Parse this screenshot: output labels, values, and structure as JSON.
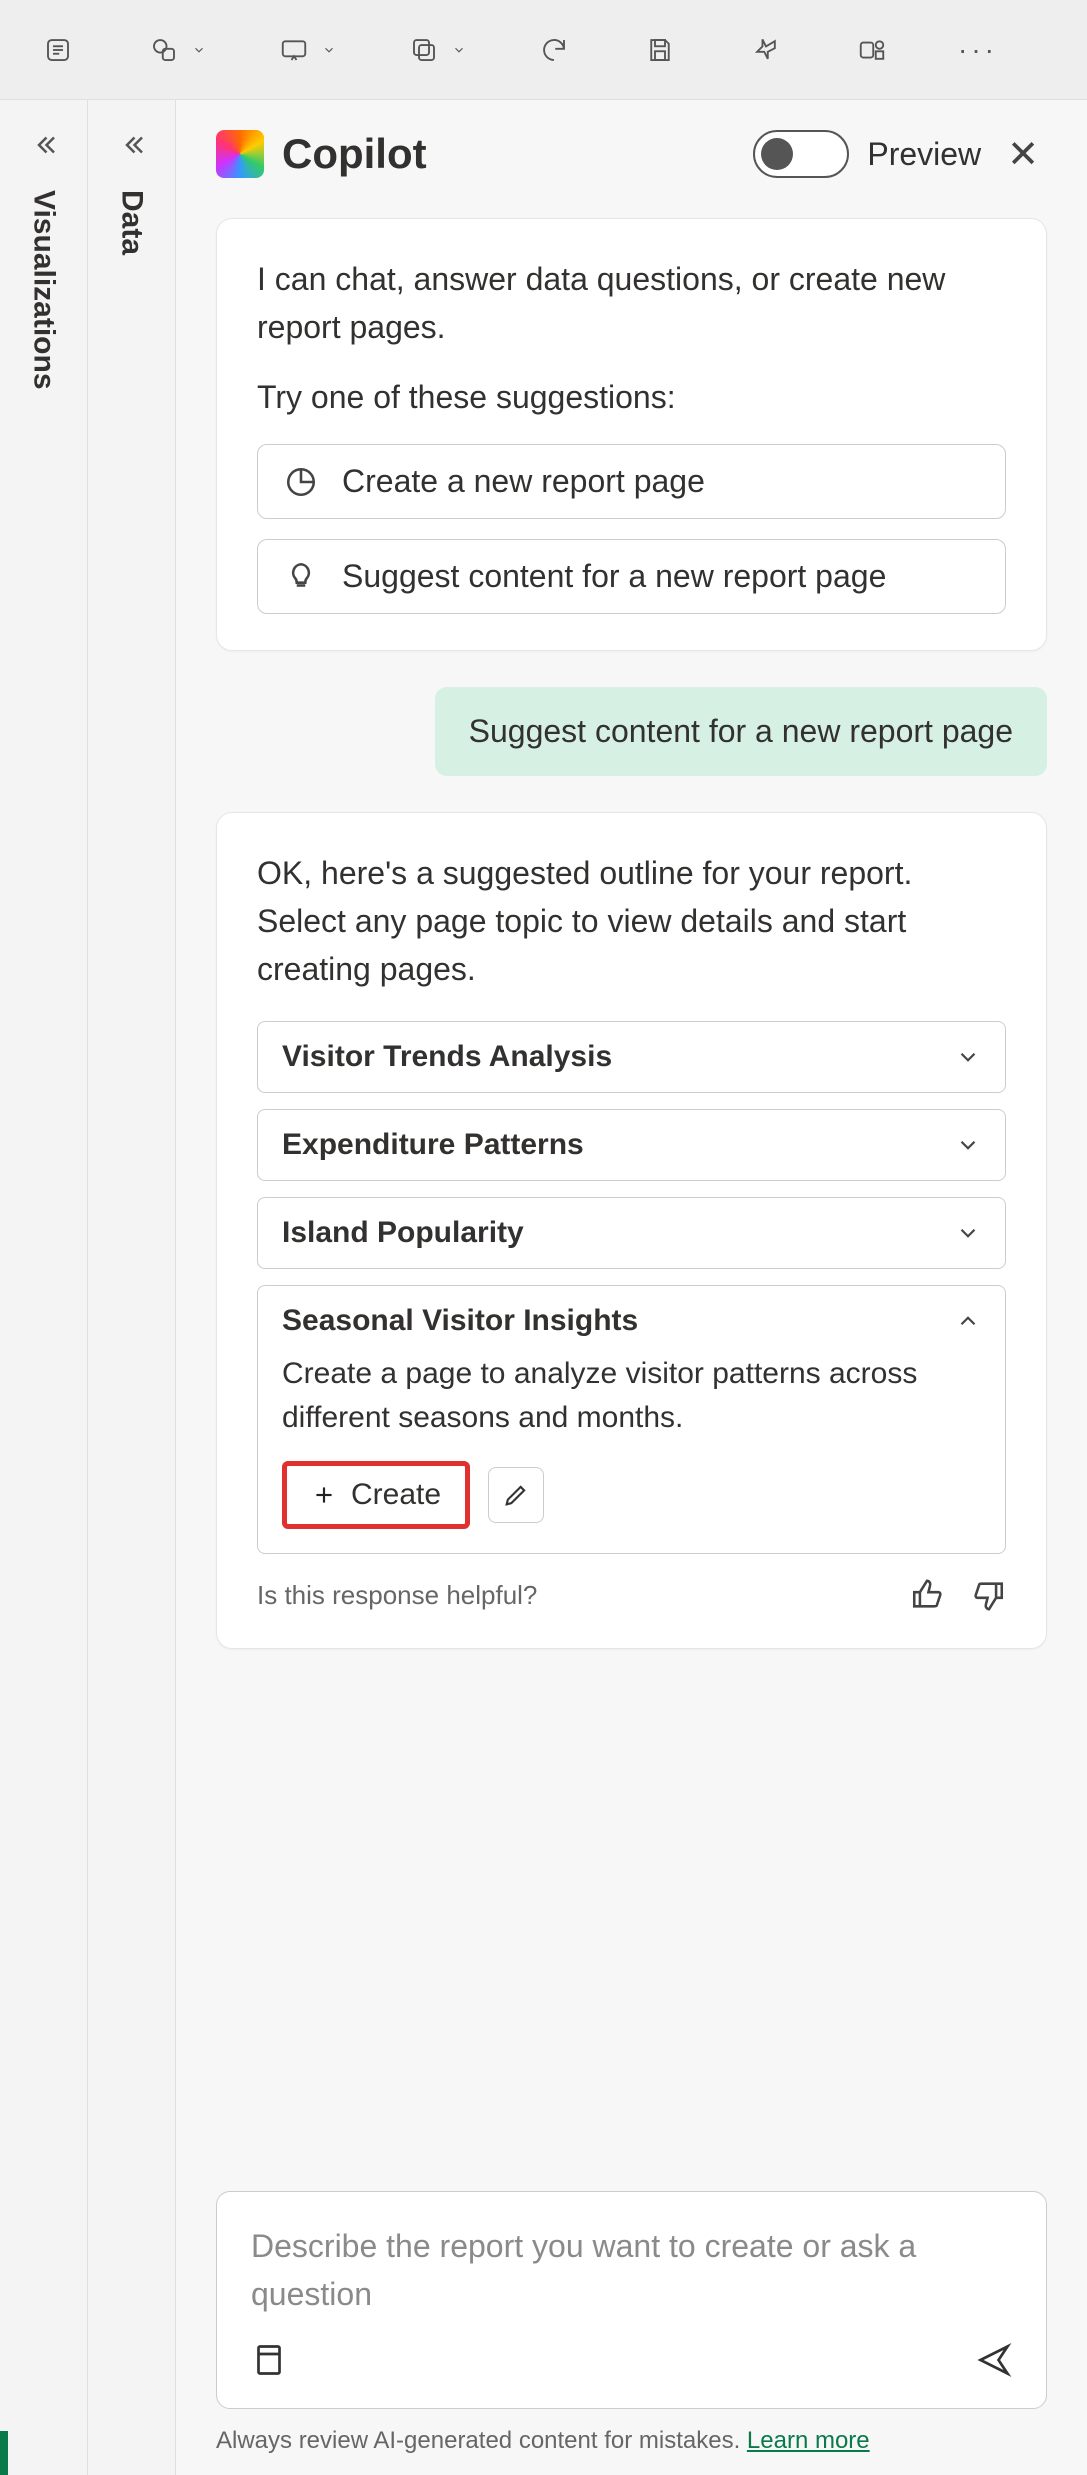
{
  "toolbar": {},
  "rails": {
    "viz_label": "Visualizations",
    "data_label": "Data"
  },
  "header": {
    "title": "Copilot",
    "preview": "Preview"
  },
  "intro": {
    "text": "I can chat, answer data questions, or create new report pages.",
    "try": "Try one of these suggestions:",
    "sugg1": "Create a new report page",
    "sugg2": "Suggest content for a new report page"
  },
  "user_message": "Suggest content for a new report page",
  "outline": {
    "text": "OK, here's a suggested outline for your report. Select any page topic to view details and start creating pages.",
    "topics": [
      "Visitor Trends Analysis",
      "Expenditure Patterns",
      "Island Popularity"
    ],
    "expanded": {
      "title": "Seasonal Visitor Insights",
      "desc": "Create a page to analyze visitor patterns across different seasons and months.",
      "create": "Create"
    }
  },
  "feedback": {
    "text": "Is this response helpful?"
  },
  "input": {
    "placeholder": "Describe the report you want to create or ask a question"
  },
  "disclaimer": {
    "text": "Always review AI-generated content for mistakes. ",
    "link": "Learn more"
  }
}
